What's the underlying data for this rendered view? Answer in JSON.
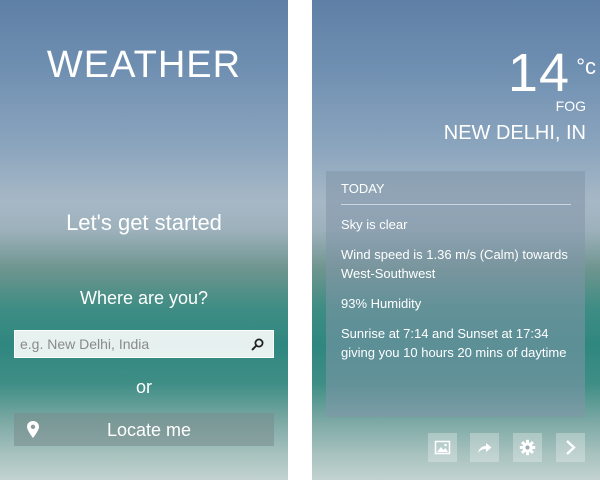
{
  "start_screen": {
    "title": "WEATHER",
    "subtitle": "Let's get started",
    "prompt": "Where are you?",
    "search": {
      "placeholder": "e.g. New Delhi, India",
      "value": ""
    },
    "separator": "or",
    "locate_button_label": "Locate me",
    "icons": {
      "search": "search-icon",
      "locate": "map-pin-icon"
    }
  },
  "weather_screen": {
    "temperature": "14",
    "unit": "°c",
    "condition": "FOG",
    "location": "NEW DELHI, IN",
    "today": {
      "heading": "TODAY",
      "sky": "Sky is clear",
      "wind": "Wind speed is 1.36 m/s (Calm) towards West-Southwest",
      "humidity": "93% Humidity",
      "sun": "Sunrise at 7:14 and Sunset at 17:34 giving you 10 hours 20 mins of daytime"
    },
    "actions": [
      {
        "icon": "image-icon"
      },
      {
        "icon": "share-arrow-icon"
      },
      {
        "icon": "gear-icon"
      },
      {
        "icon": "chevron-right-icon"
      }
    ]
  },
  "colors": {
    "sky_top": "#5f80a6",
    "sea_mid": "#2f877f",
    "text": "#ffffff"
  }
}
